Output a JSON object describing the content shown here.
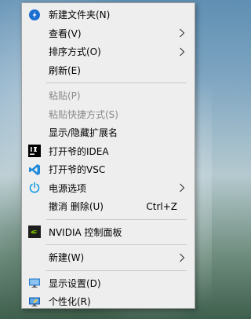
{
  "menu": {
    "items": [
      {
        "type": "item",
        "label": "新建文件夹(N)",
        "icon": "new-folder-icon",
        "submenu": false,
        "disabled": false
      },
      {
        "type": "item",
        "label": "查看(V)",
        "icon": "",
        "submenu": true,
        "disabled": false
      },
      {
        "type": "item",
        "label": "排序方式(O)",
        "icon": "",
        "submenu": true,
        "disabled": false
      },
      {
        "type": "item",
        "label": "刷新(E)",
        "icon": "",
        "submenu": false,
        "disabled": false
      },
      {
        "type": "separator"
      },
      {
        "type": "item",
        "label": "粘贴(P)",
        "icon": "",
        "submenu": false,
        "disabled": true
      },
      {
        "type": "item",
        "label": "粘贴快捷方式(S)",
        "icon": "",
        "submenu": false,
        "disabled": true
      },
      {
        "type": "item",
        "label": "显示/隐藏扩展名",
        "icon": "",
        "submenu": false,
        "disabled": false
      },
      {
        "type": "item",
        "label": "打开爷的IDEA",
        "icon": "intellij-idea-icon",
        "submenu": false,
        "disabled": false
      },
      {
        "type": "item",
        "label": "打开爷的VSC",
        "icon": "vscode-icon",
        "submenu": false,
        "disabled": false
      },
      {
        "type": "item",
        "label": "电源选项",
        "icon": "power-icon",
        "submenu": true,
        "disabled": false
      },
      {
        "type": "item",
        "label": "撤消 删除(U)",
        "icon": "",
        "shortcut": "Ctrl+Z",
        "submenu": false,
        "disabled": false
      },
      {
        "type": "separator"
      },
      {
        "type": "item",
        "label": "NVIDIA 控制面板",
        "icon": "nvidia-icon",
        "submenu": false,
        "disabled": false
      },
      {
        "type": "separator"
      },
      {
        "type": "item",
        "label": "新建(W)",
        "icon": "",
        "submenu": true,
        "disabled": false
      },
      {
        "type": "separator"
      },
      {
        "type": "item",
        "label": "显示设置(D)",
        "icon": "display-settings-icon",
        "submenu": false,
        "disabled": false
      },
      {
        "type": "item",
        "label": "个性化(R)",
        "icon": "personalize-icon",
        "submenu": false,
        "disabled": false
      }
    ]
  },
  "colors": {
    "menu_bg": "#eeeeee",
    "disabled_text": "#8a8a8a",
    "separator": "#c8c8c8"
  }
}
